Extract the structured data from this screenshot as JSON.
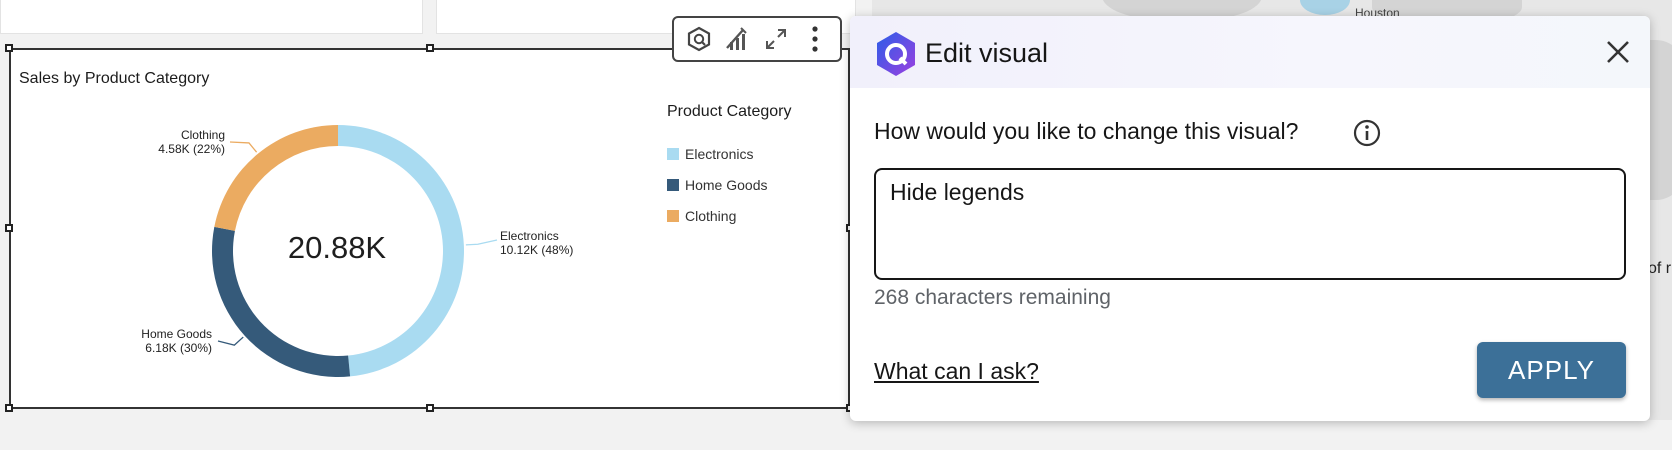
{
  "visual": {
    "title": "Sales by Product Category",
    "total": "20.88K"
  },
  "chart_data": {
    "type": "pie",
    "title": "Sales by Product Category",
    "center_label": "20.88K",
    "categories": [
      "Electronics",
      "Home Goods",
      "Clothing"
    ],
    "values": [
      10.12,
      6.18,
      4.58
    ],
    "value_unit": "K",
    "percentages": [
      48,
      30,
      22
    ],
    "colors": [
      "#a9dbf1",
      "#355a7a",
      "#ebab61"
    ],
    "donut": true,
    "legend_title": "Product Category",
    "legend_position": "right",
    "data_labels": [
      {
        "category": "Electronics",
        "value": "10.12K (48%)"
      },
      {
        "category": "Home Goods",
        "value": "6.18K (30%)"
      },
      {
        "category": "Clothing",
        "value": "4.58K (22%)"
      }
    ]
  },
  "legend": {
    "title": "Product Category",
    "items": [
      {
        "label": "Electronics",
        "color": "#a9dbf1"
      },
      {
        "label": "Home Goods",
        "color": "#355a7a"
      },
      {
        "label": "Clothing",
        "color": "#ebab61"
      }
    ]
  },
  "toolbar": {
    "icons": [
      "ai-hexagon-icon",
      "edit-visual-icon",
      "expand-icon",
      "more-options-icon"
    ]
  },
  "background": {
    "map_city": "Houston",
    "map_fragment": "of r"
  },
  "panel": {
    "title": "Edit visual",
    "question": "How would you like to change this visual?",
    "prompt_value": "Hide legends",
    "remaining": "268 characters remaining",
    "help_link": "What can I ask?",
    "apply_label": "APPLY",
    "accent_color": "#3c7098"
  }
}
